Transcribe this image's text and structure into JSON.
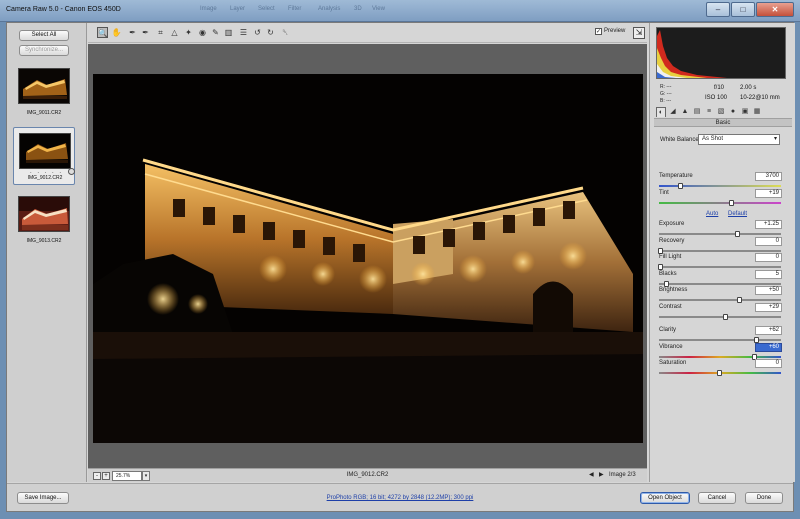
{
  "window": {
    "title": "Camera Raw 5.0  -  Canon EOS 450D",
    "background_menu_ghost": [
      "Image",
      "Layer",
      "Select",
      "Filter",
      "Analysis",
      "3D",
      "View"
    ],
    "controls": {
      "minimize": "–",
      "maximize": "□",
      "close": "✕"
    }
  },
  "filmstrip": {
    "select_all": "Select All",
    "synchronize": "Synchronize...",
    "items": [
      {
        "name": "IMG_9011.CR2",
        "selected": false
      },
      {
        "name": "IMG_9012.CR2",
        "selected": true,
        "rating_dots": ". . . . ."
      },
      {
        "name": "IMG_9013.CR2",
        "selected": false
      }
    ]
  },
  "toolbar": {
    "tools": [
      {
        "icon": "zoom-icon",
        "glyph": "🔍"
      },
      {
        "icon": "hand-icon",
        "glyph": "✋"
      },
      {
        "icon": "white-balance-icon",
        "glyph": "✒"
      },
      {
        "icon": "color-sampler-icon",
        "glyph": "✒"
      },
      {
        "icon": "crop-icon",
        "glyph": "⌗"
      },
      {
        "icon": "straighten-icon",
        "glyph": "△"
      },
      {
        "icon": "retouch-icon",
        "glyph": "✦"
      },
      {
        "icon": "red-eye-icon",
        "glyph": "◉"
      },
      {
        "icon": "adjustment-brush-icon",
        "glyph": "✎"
      },
      {
        "icon": "graduated-filter-icon",
        "glyph": "▥"
      },
      {
        "icon": "preferences-icon",
        "glyph": "☰"
      },
      {
        "icon": "rotate-left-icon",
        "glyph": "↺"
      },
      {
        "icon": "rotate-right-icon",
        "glyph": "↻"
      },
      {
        "icon": "trash-icon",
        "glyph": "␡"
      }
    ],
    "preview_label": "Preview",
    "preview_checked": true,
    "fullscreen_glyph": "⇲"
  },
  "status": {
    "zoom_minus": "-",
    "zoom_plus": "+",
    "zoom_value": "25.7%",
    "filename": "IMG_9012.CR2",
    "prev": "◀",
    "next": "▶",
    "image_count": "Image 2/3"
  },
  "histogram": {
    "r_label": "R:",
    "g_label": "G:",
    "b_label": "B:",
    "rgb_values": "---",
    "aperture": "f/10",
    "shutter": "2.00 s",
    "iso": "ISO 100",
    "lens": "10-22@10 mm"
  },
  "panel": {
    "title": "Basic",
    "tabs": [
      "◐",
      "◢",
      "▲",
      "▤",
      "≡",
      "▧",
      "●",
      "▣",
      "▦"
    ],
    "white_balance_label": "White Balance:",
    "white_balance_value": "As Shot",
    "auto": "Auto",
    "default": "Default",
    "sliders": [
      {
        "label": "Temperature",
        "value": "3700",
        "level": 0.17,
        "group": "wb"
      },
      {
        "label": "Tint",
        "value": "+19",
        "level": 0.6,
        "group": "wb"
      },
      {
        "label": "Exposure",
        "value": "+1.25",
        "level": 0.65,
        "group": "tone"
      },
      {
        "label": "Recovery",
        "value": "0",
        "level": 0.0,
        "group": "tone"
      },
      {
        "label": "Fill Light",
        "value": "0",
        "level": 0.0,
        "group": "tone"
      },
      {
        "label": "Blacks",
        "value": "5",
        "level": 0.05,
        "group": "tone"
      },
      {
        "label": "Brightness",
        "value": "+50",
        "level": 0.67,
        "group": "tone"
      },
      {
        "label": "Contrast",
        "value": "+29",
        "level": 0.55,
        "group": "tone"
      },
      {
        "label": "Clarity",
        "value": "+62",
        "level": 0.81,
        "group": "presence"
      },
      {
        "label": "Vibrance",
        "value": "+60",
        "level": 0.8,
        "group": "presence",
        "highlight": true
      },
      {
        "label": "Saturation",
        "value": "0",
        "level": 0.5,
        "group": "presence"
      }
    ]
  },
  "bottom": {
    "save_image": "Save Image...",
    "workflow": "ProPhoto RGB; 16 bit; 4272 by 2848 (12.2MP); 300 ppi",
    "open_object": "Open Object",
    "cancel": "Cancel",
    "done": "Done"
  },
  "colors": {
    "accent_blue": "#1d3fa8",
    "highlight_blue": "#3a6ad0",
    "photo_glow": "#f3b24a"
  }
}
